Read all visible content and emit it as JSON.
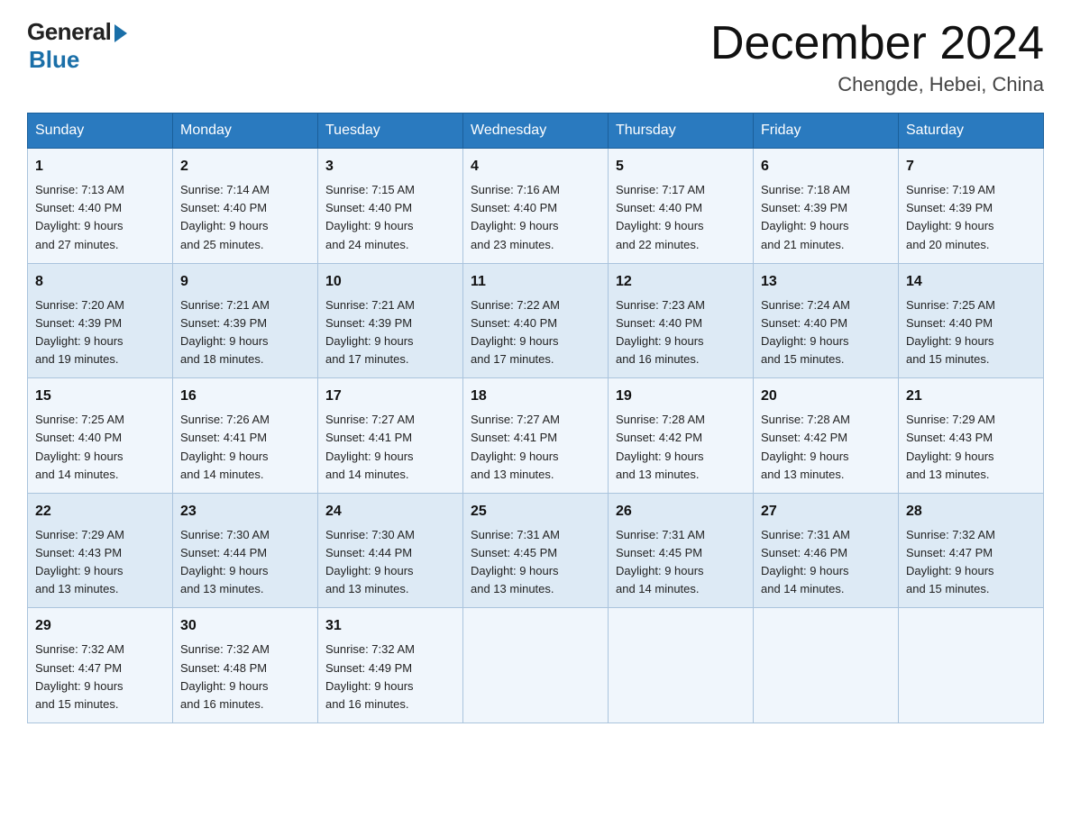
{
  "header": {
    "logo_general": "General",
    "logo_blue": "Blue",
    "month_title": "December 2024",
    "location": "Chengde, Hebei, China"
  },
  "days_of_week": [
    "Sunday",
    "Monday",
    "Tuesday",
    "Wednesday",
    "Thursday",
    "Friday",
    "Saturday"
  ],
  "weeks": [
    [
      {
        "day": "1",
        "sunrise": "7:13 AM",
        "sunset": "4:40 PM",
        "daylight": "9 hours and 27 minutes."
      },
      {
        "day": "2",
        "sunrise": "7:14 AM",
        "sunset": "4:40 PM",
        "daylight": "9 hours and 25 minutes."
      },
      {
        "day": "3",
        "sunrise": "7:15 AM",
        "sunset": "4:40 PM",
        "daylight": "9 hours and 24 minutes."
      },
      {
        "day": "4",
        "sunrise": "7:16 AM",
        "sunset": "4:40 PM",
        "daylight": "9 hours and 23 minutes."
      },
      {
        "day": "5",
        "sunrise": "7:17 AM",
        "sunset": "4:40 PM",
        "daylight": "9 hours and 22 minutes."
      },
      {
        "day": "6",
        "sunrise": "7:18 AM",
        "sunset": "4:39 PM",
        "daylight": "9 hours and 21 minutes."
      },
      {
        "day": "7",
        "sunrise": "7:19 AM",
        "sunset": "4:39 PM",
        "daylight": "9 hours and 20 minutes."
      }
    ],
    [
      {
        "day": "8",
        "sunrise": "7:20 AM",
        "sunset": "4:39 PM",
        "daylight": "9 hours and 19 minutes."
      },
      {
        "day": "9",
        "sunrise": "7:21 AM",
        "sunset": "4:39 PM",
        "daylight": "9 hours and 18 minutes."
      },
      {
        "day": "10",
        "sunrise": "7:21 AM",
        "sunset": "4:39 PM",
        "daylight": "9 hours and 17 minutes."
      },
      {
        "day": "11",
        "sunrise": "7:22 AM",
        "sunset": "4:40 PM",
        "daylight": "9 hours and 17 minutes."
      },
      {
        "day": "12",
        "sunrise": "7:23 AM",
        "sunset": "4:40 PM",
        "daylight": "9 hours and 16 minutes."
      },
      {
        "day": "13",
        "sunrise": "7:24 AM",
        "sunset": "4:40 PM",
        "daylight": "9 hours and 15 minutes."
      },
      {
        "day": "14",
        "sunrise": "7:25 AM",
        "sunset": "4:40 PM",
        "daylight": "9 hours and 15 minutes."
      }
    ],
    [
      {
        "day": "15",
        "sunrise": "7:25 AM",
        "sunset": "4:40 PM",
        "daylight": "9 hours and 14 minutes."
      },
      {
        "day": "16",
        "sunrise": "7:26 AM",
        "sunset": "4:41 PM",
        "daylight": "9 hours and 14 minutes."
      },
      {
        "day": "17",
        "sunrise": "7:27 AM",
        "sunset": "4:41 PM",
        "daylight": "9 hours and 14 minutes."
      },
      {
        "day": "18",
        "sunrise": "7:27 AM",
        "sunset": "4:41 PM",
        "daylight": "9 hours and 13 minutes."
      },
      {
        "day": "19",
        "sunrise": "7:28 AM",
        "sunset": "4:42 PM",
        "daylight": "9 hours and 13 minutes."
      },
      {
        "day": "20",
        "sunrise": "7:28 AM",
        "sunset": "4:42 PM",
        "daylight": "9 hours and 13 minutes."
      },
      {
        "day": "21",
        "sunrise": "7:29 AM",
        "sunset": "4:43 PM",
        "daylight": "9 hours and 13 minutes."
      }
    ],
    [
      {
        "day": "22",
        "sunrise": "7:29 AM",
        "sunset": "4:43 PM",
        "daylight": "9 hours and 13 minutes."
      },
      {
        "day": "23",
        "sunrise": "7:30 AM",
        "sunset": "4:44 PM",
        "daylight": "9 hours and 13 minutes."
      },
      {
        "day": "24",
        "sunrise": "7:30 AM",
        "sunset": "4:44 PM",
        "daylight": "9 hours and 13 minutes."
      },
      {
        "day": "25",
        "sunrise": "7:31 AM",
        "sunset": "4:45 PM",
        "daylight": "9 hours and 13 minutes."
      },
      {
        "day": "26",
        "sunrise": "7:31 AM",
        "sunset": "4:45 PM",
        "daylight": "9 hours and 14 minutes."
      },
      {
        "day": "27",
        "sunrise": "7:31 AM",
        "sunset": "4:46 PM",
        "daylight": "9 hours and 14 minutes."
      },
      {
        "day": "28",
        "sunrise": "7:32 AM",
        "sunset": "4:47 PM",
        "daylight": "9 hours and 15 minutes."
      }
    ],
    [
      {
        "day": "29",
        "sunrise": "7:32 AM",
        "sunset": "4:47 PM",
        "daylight": "9 hours and 15 minutes."
      },
      {
        "day": "30",
        "sunrise": "7:32 AM",
        "sunset": "4:48 PM",
        "daylight": "9 hours and 16 minutes."
      },
      {
        "day": "31",
        "sunrise": "7:32 AM",
        "sunset": "4:49 PM",
        "daylight": "9 hours and 16 minutes."
      },
      null,
      null,
      null,
      null
    ]
  ],
  "labels": {
    "sunrise": "Sunrise: ",
    "sunset": "Sunset: ",
    "daylight": "Daylight: "
  }
}
